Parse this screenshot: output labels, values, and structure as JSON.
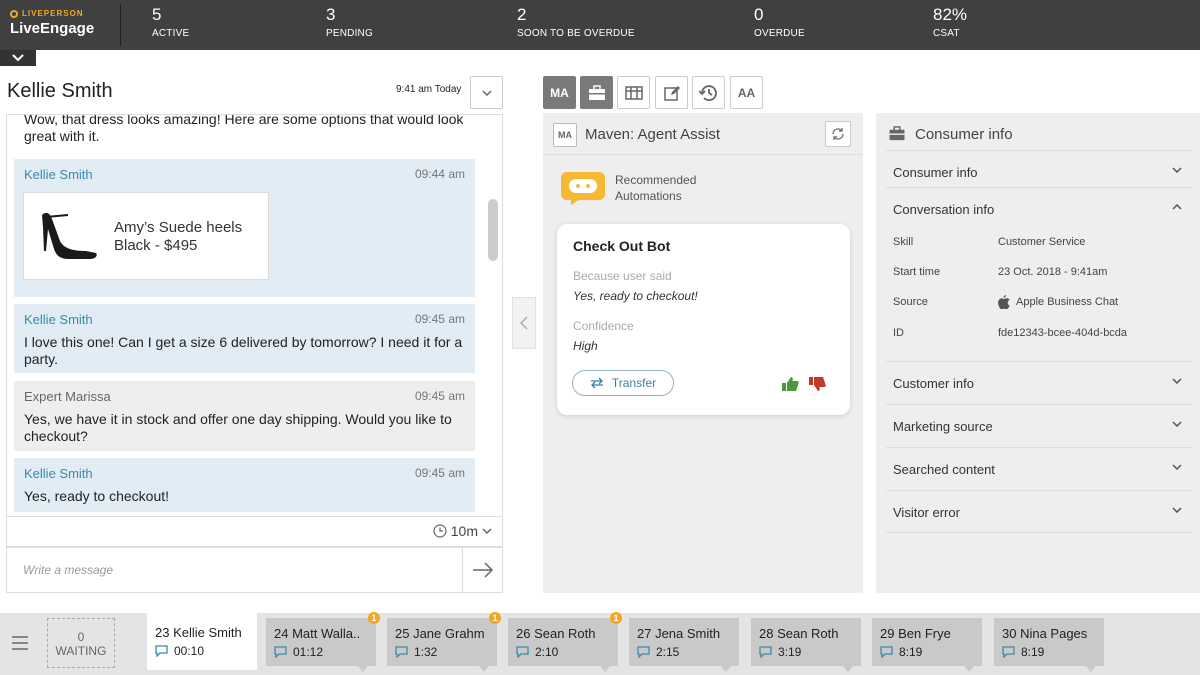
{
  "app": {
    "brand": "LIVEPERSON",
    "name": "LiveEngage"
  },
  "stats": [
    {
      "value": "5",
      "label": "ACTIVE"
    },
    {
      "value": "3",
      "label": "PENDING"
    },
    {
      "value": "2",
      "label": "SOON TO BE OVERDUE"
    },
    {
      "value": "0",
      "label": "OVERDUE"
    },
    {
      "value": "82%",
      "label": "CSAT"
    }
  ],
  "chat": {
    "title": "Kellie Smith",
    "time": "9:41 am Today",
    "messages": [
      {
        "text": "Wow, that dress looks amazing! Here are some options that would look great with it."
      },
      {
        "who": "Kellie Smith",
        "when": "09:44 am",
        "product": {
          "name": "Amy’s Suede heels",
          "price": "Black - $495"
        }
      },
      {
        "who": "Kellie Smith",
        "when": "09:45 am",
        "text": "I love this one! Can I get a size 6 delivered by tomorrow? I need it for a party."
      },
      {
        "who": "Expert Marissa",
        "when": "09:45 am",
        "text": "Yes, we have it in stock and offer one day shipping. Would you like to checkout?"
      },
      {
        "who": "Kellie Smith",
        "when": "09:45 am",
        "text": "Yes, ready to checkout!"
      }
    ],
    "timer": "10m",
    "compose_placeholder": "Write a message"
  },
  "tools": [
    "MA",
    "briefcase-icon",
    "columns-icon",
    "edit-icon",
    "history-icon",
    "AA"
  ],
  "maven": {
    "badge": "MA",
    "title": "Maven: Agent Assist",
    "recommended": [
      "Recommended",
      "Automations"
    ],
    "card": {
      "title": "Check Out Bot",
      "because_label": "Because user said",
      "because_value": "Yes, ready to checkout!",
      "confidence_label": "Confidence",
      "confidence_value": "High",
      "transfer": "Transfer"
    }
  },
  "consumer": {
    "title": "Consumer info",
    "sections": [
      "Consumer info",
      "Conversation info",
      "Customer info",
      "Marketing source",
      "Searched content",
      "Visitor error"
    ],
    "conversation": {
      "skill_label": "Skill",
      "skill": "Customer Service",
      "start_label": "Start time",
      "start": "23 Oct. 2018 - 9:41am",
      "source_label": "Source",
      "source": "Apple Business Chat",
      "id_label": "ID",
      "id": "fde12343-bcee-404d-bcda"
    }
  },
  "bottom": {
    "waiting_count": "0",
    "waiting_label": "WAITING",
    "conversations": [
      {
        "name": "23 Kellie Smith",
        "time": "00:10",
        "alert": ""
      },
      {
        "name": "24 Matt Walla..",
        "time": "01:12",
        "alert": "1"
      },
      {
        "name": "25 Jane Grahm",
        "time": "1:32",
        "alert": "1"
      },
      {
        "name": "26 Sean Roth",
        "time": "2:10",
        "alert": "1"
      },
      {
        "name": "27 Jena Smith",
        "time": "2:15",
        "alert": ""
      },
      {
        "name": "28 Sean Roth",
        "time": "3:19",
        "alert": ""
      },
      {
        "name": "29 Ben Frye",
        "time": "8:19",
        "alert": ""
      },
      {
        "name": "30 Nina Pages",
        "time": "8:19",
        "alert": ""
      }
    ]
  },
  "colors": {
    "topbar": "#404040",
    "accent": "#f5a623",
    "link": "#3a8aa8",
    "thumb_up": "#4a9a3a",
    "thumb_down": "#c0392b"
  }
}
